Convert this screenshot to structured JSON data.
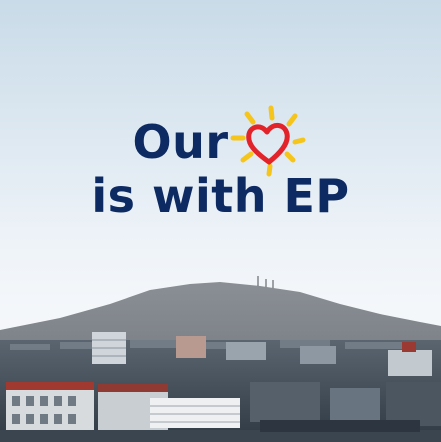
{
  "headline": {
    "line1_word": "Our",
    "line2": "is with EP"
  },
  "icon_names": {
    "heart": "heart-sun-icon"
  },
  "colors": {
    "headline": "#0d2a63",
    "heart": "#e2232a",
    "sun_rays": "#f5c51b"
  }
}
